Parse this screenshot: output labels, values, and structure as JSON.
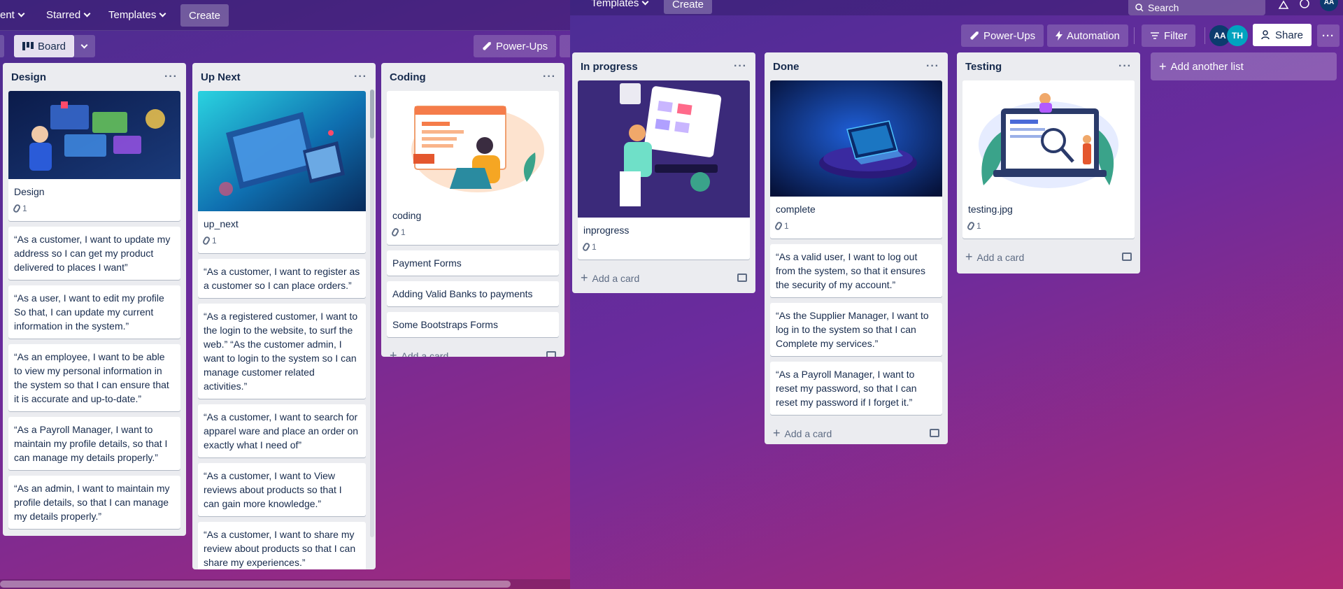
{
  "left_nav": {
    "item_partial": "ent",
    "starred": "Starred",
    "templates": "Templates",
    "create": "Create"
  },
  "left_board_bar": {
    "board_view": "Board",
    "power_ups": "Power-Ups"
  },
  "right_nav": {
    "templates": "Templates",
    "create": "Create",
    "search_placeholder": "Search",
    "account_initials": "AA"
  },
  "right_board_bar": {
    "power_ups": "Power-Ups",
    "automation": "Automation",
    "filter": "Filter",
    "members": [
      "AA",
      "TH"
    ],
    "share": "Share"
  },
  "add_card_label": "Add a card",
  "add_another_list": "Add another list",
  "lists": {
    "design": {
      "title": "Design",
      "cover_title": "Design",
      "attachments": "1",
      "cards": [
        "“As a customer, I want to update my address so I can get my product delivered to places I want”",
        "“As a user, I want to edit my profile So that, I can update my current information in the system.”",
        "“As an employee, I want to be able to view my personal information in the system so that I can ensure that it is accurate and up-to-date.”",
        "“As a Payroll Manager, I want to maintain my profile details, so that I can manage my details properly.”",
        "“As an admin, I want to maintain my profile details, so that I can manage my details properly.”"
      ]
    },
    "up_next": {
      "title": "Up Next",
      "cover_title": "up_next",
      "attachments": "1",
      "cards": [
        "“As a customer, I want to register as a customer so I can place orders.”",
        "“As a registered customer, I want to the login to the website, to surf the web.” “As the customer admin, I want to login to the system so I can manage customer related activities.”",
        "“As a customer, I want to search for apparel ware and place an order on exactly what I need of”",
        "“As a customer, I want to View reviews about products so that I can gain more knowledge.”",
        "“As a customer, I want to share my review about products so that I can share my experiences.”"
      ]
    },
    "coding": {
      "title": "Coding",
      "cover_title": "coding",
      "attachments": "1",
      "cards": [
        "Payment Forms",
        "Adding Valid Banks to payments",
        "Some Bootstraps Forms"
      ]
    },
    "in_progress": {
      "title": "In progress",
      "cover_title": "inprogress",
      "attachments": "1",
      "cards": []
    },
    "done": {
      "title": "Done",
      "cover_title": "complete",
      "attachments": "1",
      "cards": [
        "“As a valid user, I want to log out from the system, so that it ensures the security of my account.”",
        "“As the Supplier Manager, I want to log in to the system so that I can Complete my services.”",
        "“As a Payroll Manager, I want to reset my password, so that I can reset my password if I forget it.”"
      ]
    },
    "testing": {
      "title": "Testing",
      "cover_title": "testing.jpg",
      "attachments": "1",
      "cards": []
    }
  },
  "colors": {
    "list_bg": "#ebecf0",
    "avatar_aa": "#0c3b6e",
    "avatar_th": "#00a3bf"
  }
}
